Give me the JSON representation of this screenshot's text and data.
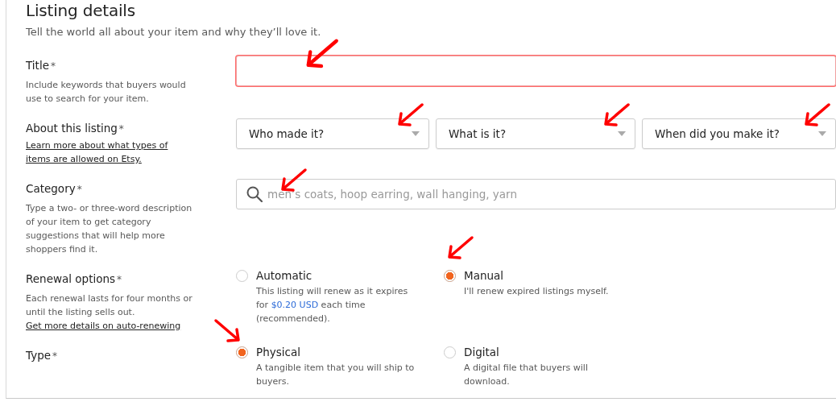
{
  "heading": "Listing details",
  "subheading": "Tell the world all about your item and why they’ll love it.",
  "title_field": {
    "label": "Title",
    "required": "*",
    "description": "Include keywords that buyers would use to search for your item.",
    "error": true,
    "arrow": true
  },
  "about_listing": {
    "label": "About this listing",
    "required": "*",
    "link": "Learn more about what types of items are allowed on Etsy.",
    "dropdowns": [
      {
        "placeholder": "Who made it?",
        "arrow": true
      },
      {
        "placeholder": "What is it?",
        "arrow": true
      },
      {
        "placeholder": "When did you make it?",
        "arrow": true
      }
    ]
  },
  "category": {
    "label": "Category",
    "required": "*",
    "description": "Type a two- or three-word description of your item to get category suggestions that will help more shoppers find it.",
    "placeholder": "men’s coats, hoop earring, wall hanging, yarn",
    "arrow": true
  },
  "renewal_options": {
    "label": "Renewal options",
    "required": "*",
    "description": "Each renewal lasts for four months or until the listing sells out.",
    "link": "Get more details on auto-renewing",
    "options": [
      {
        "label": "Automatic",
        "description": "This listing will renew as it expires for **$0.20 USD** each time (recommended).",
        "selected": false,
        "arrow": false
      },
      {
        "label": "Manual",
        "description": "I'll renew expired listings myself.",
        "selected": true,
        "arrow": true
      }
    ]
  },
  "type": {
    "label": "Type",
    "required": "*",
    "options": [
      {
        "label": "Physical",
        "description": "A tangible item that you will ship to buyers.",
        "selected": true,
        "arrow": true
      },
      {
        "label": "Digital",
        "description": "A digital file that buyers will download.",
        "selected": false,
        "arrow": false
      }
    ]
  }
}
